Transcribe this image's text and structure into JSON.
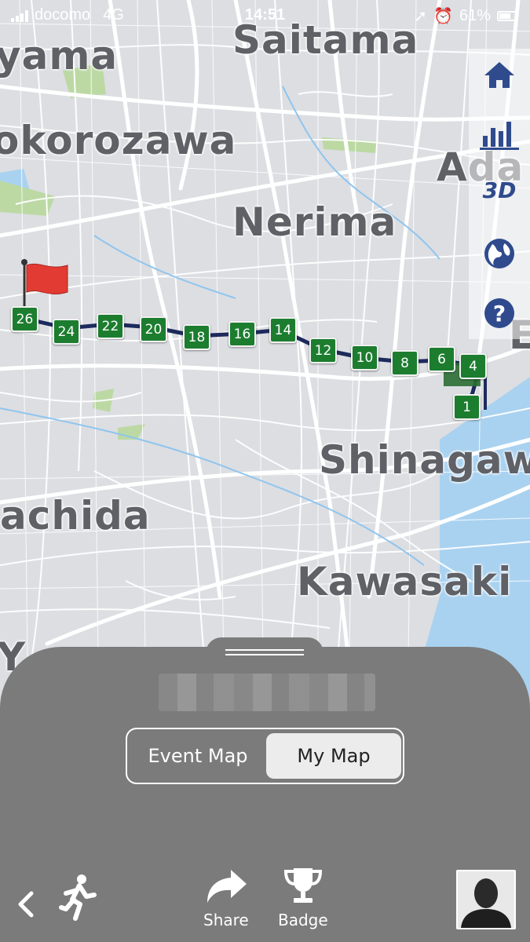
{
  "status_bar": {
    "carrier": "docomo",
    "network": "4G",
    "time": "14:51",
    "battery": "61%"
  },
  "map": {
    "cities": {
      "saitama": "Saitama",
      "yama": "yama",
      "tokorozawa": "okorozawa",
      "ada": "Ada",
      "nerima": "Nerima",
      "shinagawa": "Shinagaw",
      "machida": "achida",
      "kawasaki": "Kawasaki",
      "edge_e": "E",
      "yoko": "Y"
    },
    "route_markers": [
      "1",
      "4",
      "6",
      "8",
      "10",
      "12",
      "14",
      "16",
      "18",
      "20",
      "22",
      "24",
      "26"
    ],
    "marker_color": "#1c7d2f",
    "route_color": "#1d2a5c",
    "flag_color": "#e23b33"
  },
  "toolbar": {
    "home": "home-icon",
    "stats": "bar-chart-icon",
    "view_3d_label": "3D",
    "globe": "globe-icon",
    "help": "help-icon",
    "icon_color": "#2f4b8e"
  },
  "sheet": {
    "tabs": {
      "event_map": "Event Map",
      "my_map": "My Map"
    },
    "selected_tab": "My Map"
  },
  "bottom_bar": {
    "share": "Share",
    "badge": "Badge"
  }
}
